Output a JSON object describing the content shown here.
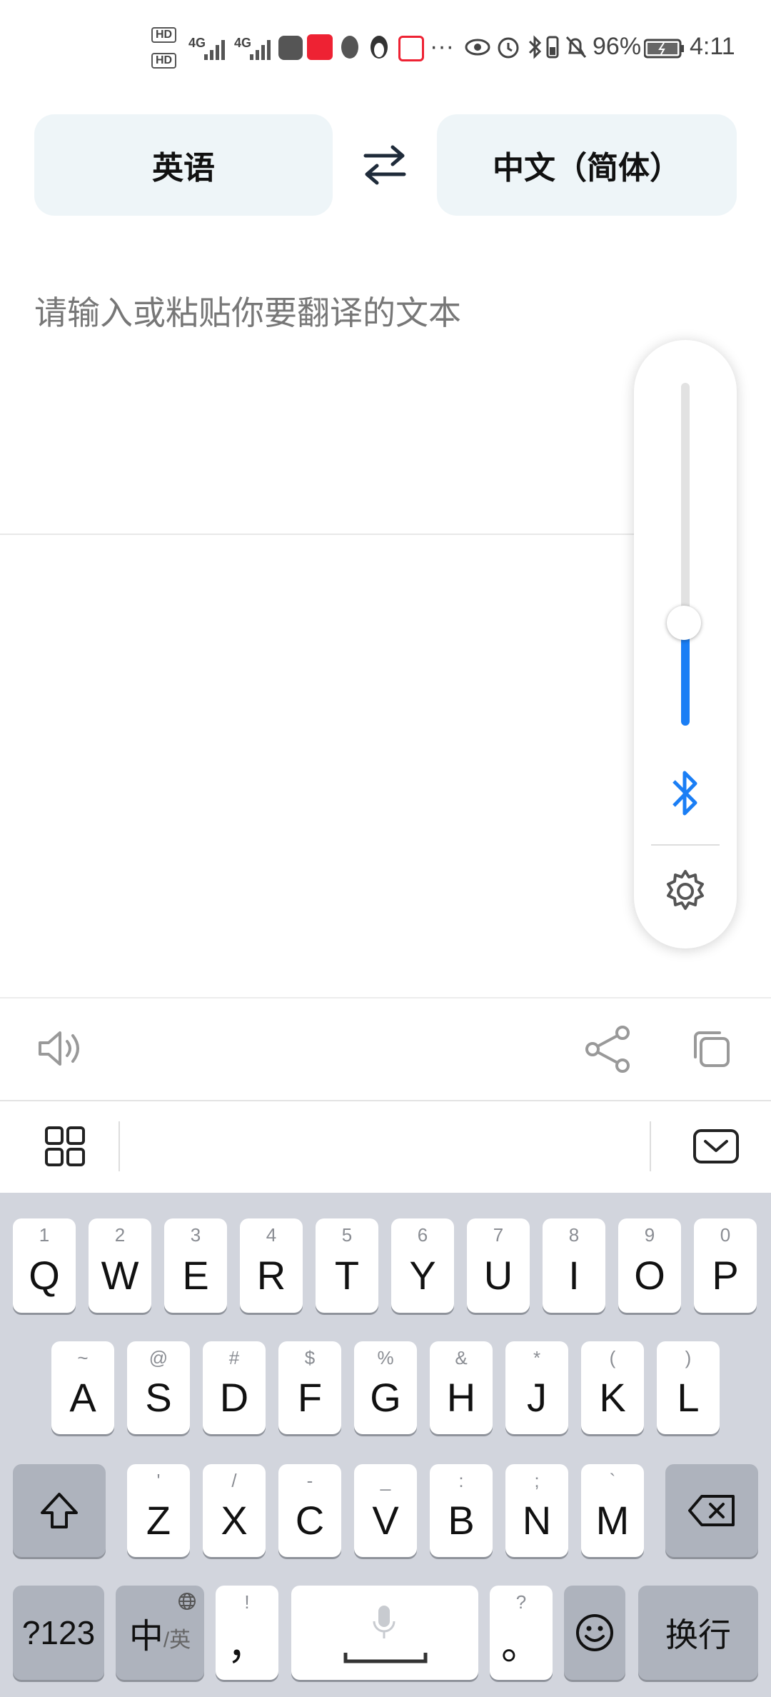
{
  "status_bar": {
    "hd1": "HD",
    "hd2": "HD",
    "net1": "4G",
    "net2": "4G",
    "more": "···",
    "battery_percent": "96%",
    "time": "4:11"
  },
  "translator": {
    "source_lang": "英语",
    "target_lang": "中文（简体）",
    "input_placeholder": "请输入或粘贴你要翻译的文本"
  },
  "volume_panel": {
    "level": 0.3
  },
  "keyboard": {
    "row1": [
      {
        "sub": "1",
        "main": "Q"
      },
      {
        "sub": "2",
        "main": "W"
      },
      {
        "sub": "3",
        "main": "E"
      },
      {
        "sub": "4",
        "main": "R"
      },
      {
        "sub": "5",
        "main": "T"
      },
      {
        "sub": "6",
        "main": "Y"
      },
      {
        "sub": "7",
        "main": "U"
      },
      {
        "sub": "8",
        "main": "I"
      },
      {
        "sub": "9",
        "main": "O"
      },
      {
        "sub": "0",
        "main": "P"
      }
    ],
    "row2": [
      {
        "sub": "~",
        "main": "A"
      },
      {
        "sub": "@",
        "main": "S"
      },
      {
        "sub": "#",
        "main": "D"
      },
      {
        "sub": "$",
        "main": "F"
      },
      {
        "sub": "%",
        "main": "G"
      },
      {
        "sub": "&",
        "main": "H"
      },
      {
        "sub": "*",
        "main": "J"
      },
      {
        "sub": "(",
        "main": "K"
      },
      {
        "sub": ")",
        "main": "L"
      }
    ],
    "row3": [
      {
        "sub": "'",
        "main": "Z"
      },
      {
        "sub": "/",
        "main": "X"
      },
      {
        "sub": "-",
        "main": "C"
      },
      {
        "sub": "_",
        "main": "V"
      },
      {
        "sub": ":",
        "main": "B"
      },
      {
        "sub": ";",
        "main": "N"
      },
      {
        "sub": "`",
        "main": "M"
      }
    ],
    "num_key": "?123",
    "lang_key_main": "中",
    "lang_key_sub": "/英",
    "comma_sub": "!",
    "comma_main": "，",
    "period_sub": "?",
    "period_main": "。",
    "enter_key": "换行"
  }
}
